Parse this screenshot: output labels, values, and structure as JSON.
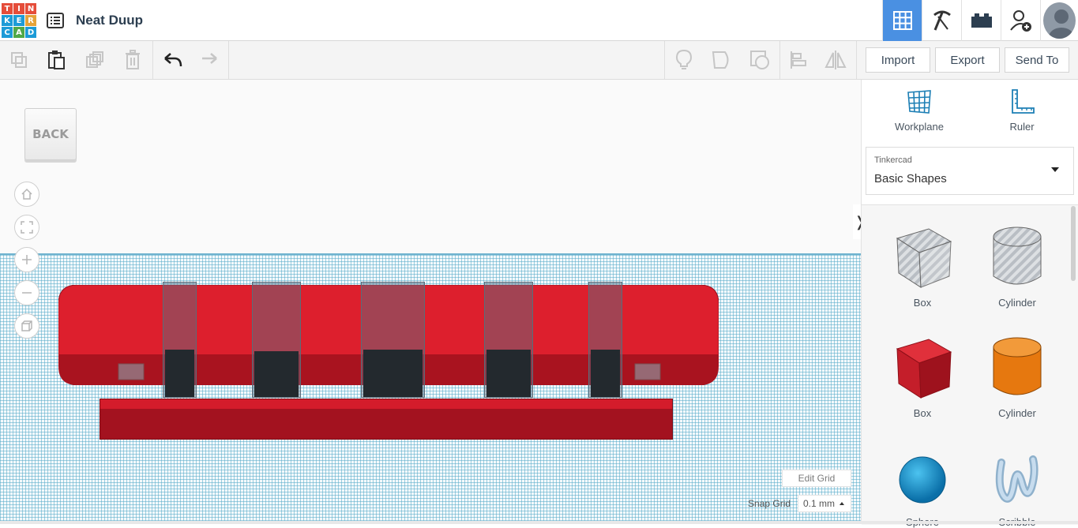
{
  "app": {
    "logo_letters": [
      "T",
      "I",
      "N",
      "K",
      "E",
      "R",
      "C",
      "A",
      "D"
    ],
    "logo_colors": [
      "#e54d3a",
      "#e54d3a",
      "#e54d3a",
      "#1d9bd7",
      "#1d9bd7",
      "#e5a33a",
      "#1d9bd7",
      "#50a848",
      "#1d9bd7"
    ],
    "design_title": "Neat Duup"
  },
  "topbar": {
    "icons": [
      "3d-view-icon",
      "pickaxe-icon",
      "bricks-icon",
      "add-user-icon"
    ],
    "accent": "#4a90e2"
  },
  "toolbar": {
    "import_label": "Import",
    "export_label": "Export",
    "sendto_label": "Send To"
  },
  "viewport": {
    "viewcube_label": "BACK",
    "edit_grid_label": "Edit Grid",
    "snap_grid_label": "Snap Grid",
    "snap_grid_value": "0.1 mm"
  },
  "panel": {
    "workplane_label": "Workplane",
    "ruler_label": "Ruler",
    "library_category": "Tinkercad",
    "library_name": "Basic Shapes",
    "shapes": [
      {
        "label": "Box",
        "icon": "box-hole-icon"
      },
      {
        "label": "Cylinder",
        "icon": "cylinder-hole-icon"
      },
      {
        "label": "Box",
        "icon": "box-red-icon"
      },
      {
        "label": "Cylinder",
        "icon": "cylinder-orange-icon"
      },
      {
        "label": "Sphere",
        "icon": "sphere-blue-icon"
      },
      {
        "label": "Scribble",
        "icon": "scribble-icon"
      }
    ]
  }
}
